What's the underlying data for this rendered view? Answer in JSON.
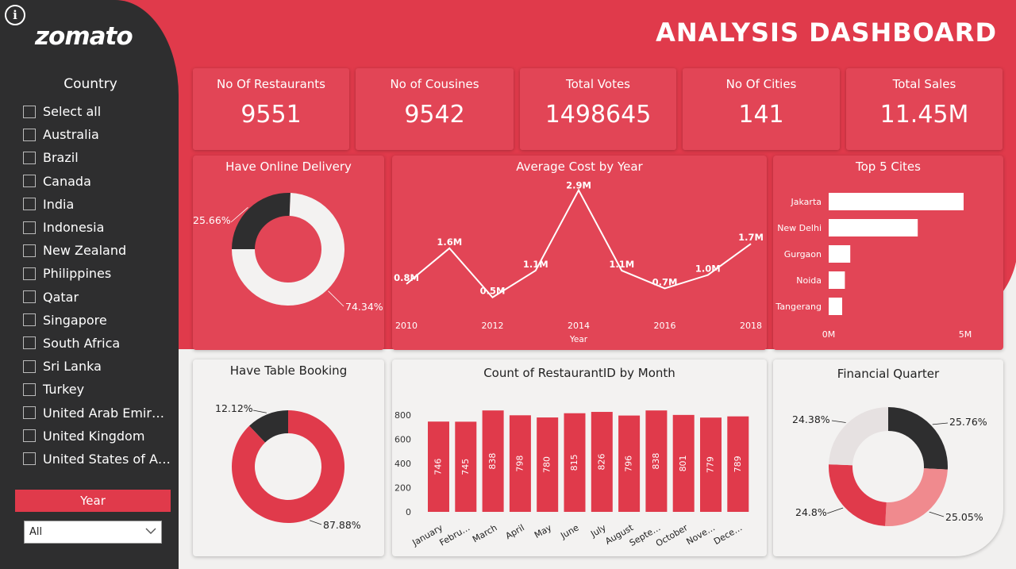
{
  "info_icon": "info-icon",
  "logo": "zomato",
  "sidebar": {
    "country_title": "Country",
    "countries": [
      "Select all",
      "Australia",
      "Brazil",
      "Canada",
      "India",
      "Indonesia",
      "New Zealand",
      "Philippines",
      "Qatar",
      "Singapore",
      "South Africa",
      "Sri Lanka",
      "Turkey",
      "United Arab Emir…",
      "United Kingdom",
      "United States of A…"
    ],
    "year_title": "Year",
    "year_value": "All"
  },
  "header": {
    "title": "ANALYSIS DASHBOARD"
  },
  "kpis": [
    {
      "label": "No Of Restaurants",
      "value": "9551"
    },
    {
      "label": "No of Cousines",
      "value": "9542"
    },
    {
      "label": "Total Votes",
      "value": "1498645"
    },
    {
      "label": "No Of Cities",
      "value": "141"
    },
    {
      "label": "Total Sales",
      "value": "11.45M"
    }
  ],
  "colors": {
    "brand_red": "#e03a4b",
    "panel_red": "#e24556",
    "dark": "#2e2e2f",
    "light_bg": "#f3f2f1",
    "salmon": "#f08a8e",
    "light_grey": "#e6e1e1"
  },
  "chart_data": [
    {
      "id": "online_delivery",
      "type": "pie",
      "title": "Have Online Delivery",
      "slices": [
        {
          "label": "25.66%",
          "value": 25.66,
          "color": "#2e2e2f"
        },
        {
          "label": "74.34%",
          "value": 74.34,
          "color": "#f3f2f1"
        }
      ]
    },
    {
      "id": "avg_cost",
      "type": "line",
      "title": "Average Cost by Year",
      "xlabel": "Year",
      "x": [
        2010,
        2011,
        2012,
        2013,
        2014,
        2015,
        2016,
        2017,
        2018
      ],
      "values": [
        0.8,
        1.6,
        0.5,
        1.1,
        2.9,
        1.1,
        0.7,
        1.0,
        1.7
      ],
      "data_labels": [
        "0.8M",
        "1.6M",
        "0.5M",
        "1.1M",
        "2.9M",
        "1.1M",
        "0.7M",
        "1.0M",
        "1.7M"
      ],
      "x_ticks": [
        "2010",
        "2012",
        "2014",
        "2016",
        "2018"
      ]
    },
    {
      "id": "top_cities",
      "type": "bar",
      "title": "Top 5 Cites",
      "categories": [
        "Jakarta",
        "New Delhi",
        "Gurgaon",
        "Noida",
        "Tangerang"
      ],
      "values": [
        5.0,
        3.3,
        0.8,
        0.6,
        0.5
      ],
      "x_ticks": [
        "0M",
        "5M"
      ],
      "xlim": [
        0,
        5
      ]
    },
    {
      "id": "table_booking",
      "type": "pie",
      "title": "Have Table Booking",
      "slices": [
        {
          "label": "12.12%",
          "value": 12.12,
          "color": "#2e2e2f"
        },
        {
          "label": "87.88%",
          "value": 87.88,
          "color": "#e03a4b"
        }
      ]
    },
    {
      "id": "by_month",
      "type": "bar",
      "title": "Count of RestaurantID by Month",
      "categories": [
        "January",
        "Febru…",
        "March",
        "April",
        "May",
        "June",
        "July",
        "August",
        "Septe…",
        "October",
        "Nove…",
        "Dece…"
      ],
      "values": [
        746,
        745,
        838,
        798,
        780,
        815,
        826,
        796,
        838,
        801,
        779,
        789
      ],
      "y_ticks": [
        "0",
        "200",
        "400",
        "600",
        "800"
      ],
      "ylim": [
        0,
        800
      ]
    },
    {
      "id": "financial_quarter",
      "type": "pie",
      "title": "Financial Quarter",
      "slices": [
        {
          "label": "25.76%",
          "value": 25.76,
          "color": "#2e2e2f"
        },
        {
          "label": "25.05%",
          "value": 25.05,
          "color": "#f08a8e"
        },
        {
          "label": "24.8%",
          "value": 24.8,
          "color": "#e03a4b"
        },
        {
          "label": "24.38%",
          "value": 24.38,
          "color": "#e6e1e1"
        }
      ]
    }
  ]
}
